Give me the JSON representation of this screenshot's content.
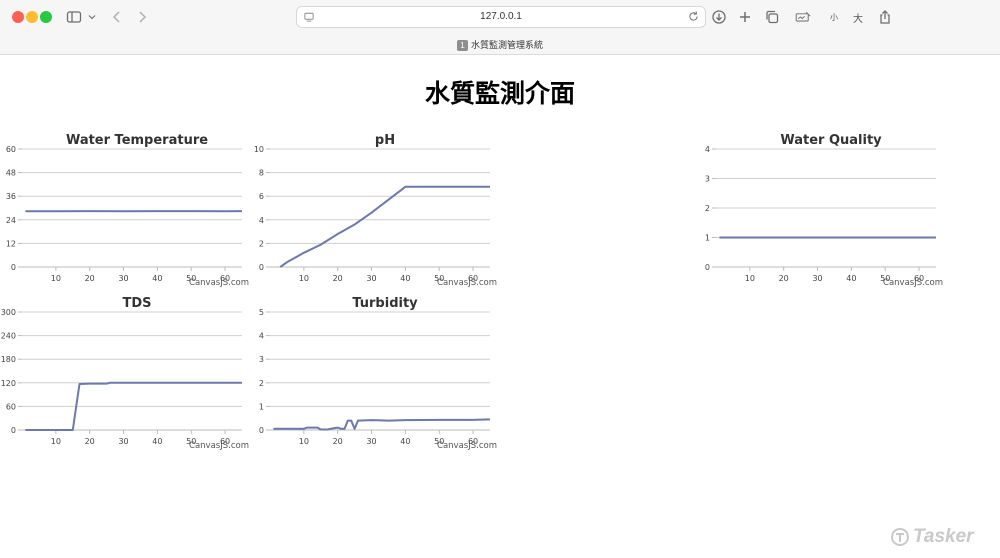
{
  "browser": {
    "url": "127.0.0.1",
    "tab_badge": "1",
    "tab_title": "水質監測管理系統",
    "text_size_small": "小",
    "text_size_large": "大"
  },
  "page": {
    "title": "水質監測介面",
    "watermark": "Tasker"
  },
  "chart_credit": "CanvasJS.com",
  "chart_data": [
    {
      "id": "temperature",
      "type": "line",
      "title": "Water Temperature",
      "color": "#6d78ad",
      "xlim": [
        0,
        65
      ],
      "x_ticks": [
        10,
        20,
        30,
        40,
        50,
        60
      ],
      "ylim": [
        0,
        60
      ],
      "y_ticks": [
        0,
        12,
        24,
        36,
        48,
        60
      ],
      "grid": true,
      "series": [
        {
          "x": [
            1,
            10,
            20,
            30,
            40,
            50,
            60,
            65
          ],
          "y": [
            28.3,
            28.3,
            28.4,
            28.3,
            28.4,
            28.4,
            28.3,
            28.4
          ]
        }
      ]
    },
    {
      "id": "ph",
      "type": "line",
      "title": "pH",
      "color": "#6d78ad",
      "xlim": [
        0,
        65
      ],
      "x_ticks": [
        10,
        20,
        30,
        40,
        50,
        60
      ],
      "ylim": [
        0,
        10
      ],
      "y_ticks": [
        0,
        2,
        4,
        6,
        8,
        10
      ],
      "grid": true,
      "series": [
        {
          "x": [
            3,
            5,
            10,
            15,
            20,
            25,
            30,
            35,
            40,
            45,
            50,
            55,
            60,
            65
          ],
          "y": [
            0,
            0.4,
            1.2,
            1.9,
            2.8,
            3.6,
            4.6,
            5.7,
            6.8,
            6.8,
            6.8,
            6.8,
            6.8,
            6.8
          ]
        }
      ]
    },
    {
      "id": "quality",
      "type": "line",
      "title": "Water Quality",
      "color": "#6d78ad",
      "xlim": [
        0,
        65
      ],
      "x_ticks": [
        10,
        20,
        30,
        40,
        50,
        60
      ],
      "ylim": [
        0,
        4
      ],
      "y_ticks": [
        0,
        1,
        2,
        3,
        4
      ],
      "grid": true,
      "series": [
        {
          "x": [
            1,
            65
          ],
          "y": [
            1,
            1
          ]
        }
      ]
    },
    {
      "id": "tds",
      "type": "line",
      "title": "TDS",
      "color": "#6d78ad",
      "xlim": [
        0,
        65
      ],
      "x_ticks": [
        10,
        20,
        30,
        40,
        50,
        60
      ],
      "ylim": [
        0,
        300
      ],
      "y_ticks": [
        0,
        60,
        120,
        180,
        240,
        300
      ],
      "grid": true,
      "series": [
        {
          "x": [
            1,
            15,
            16,
            17,
            20,
            25,
            26,
            30,
            40,
            50,
            60,
            65
          ],
          "y": [
            0,
            0,
            60,
            117,
            118,
            118,
            120,
            120,
            120,
            120,
            120,
            120
          ]
        }
      ]
    },
    {
      "id": "turbidity",
      "type": "line",
      "title": "Turbidity",
      "color": "#6d78ad",
      "xlim": [
        0,
        65
      ],
      "x_ticks": [
        10,
        20,
        30,
        40,
        50,
        60
      ],
      "ylim": [
        0,
        5
      ],
      "y_ticks": [
        0,
        1,
        2,
        3,
        4,
        5
      ],
      "grid": true,
      "series": [
        {
          "x": [
            1,
            10,
            11,
            14,
            15,
            17,
            19,
            20,
            21,
            22,
            23,
            24,
            25,
            26,
            30,
            35,
            40,
            50,
            60,
            65
          ],
          "y": [
            0.05,
            0.05,
            0.1,
            0.1,
            0.02,
            0.02,
            0.08,
            0.1,
            0.05,
            0.05,
            0.4,
            0.4,
            0.05,
            0.4,
            0.42,
            0.4,
            0.42,
            0.43,
            0.43,
            0.45
          ]
        }
      ]
    }
  ]
}
